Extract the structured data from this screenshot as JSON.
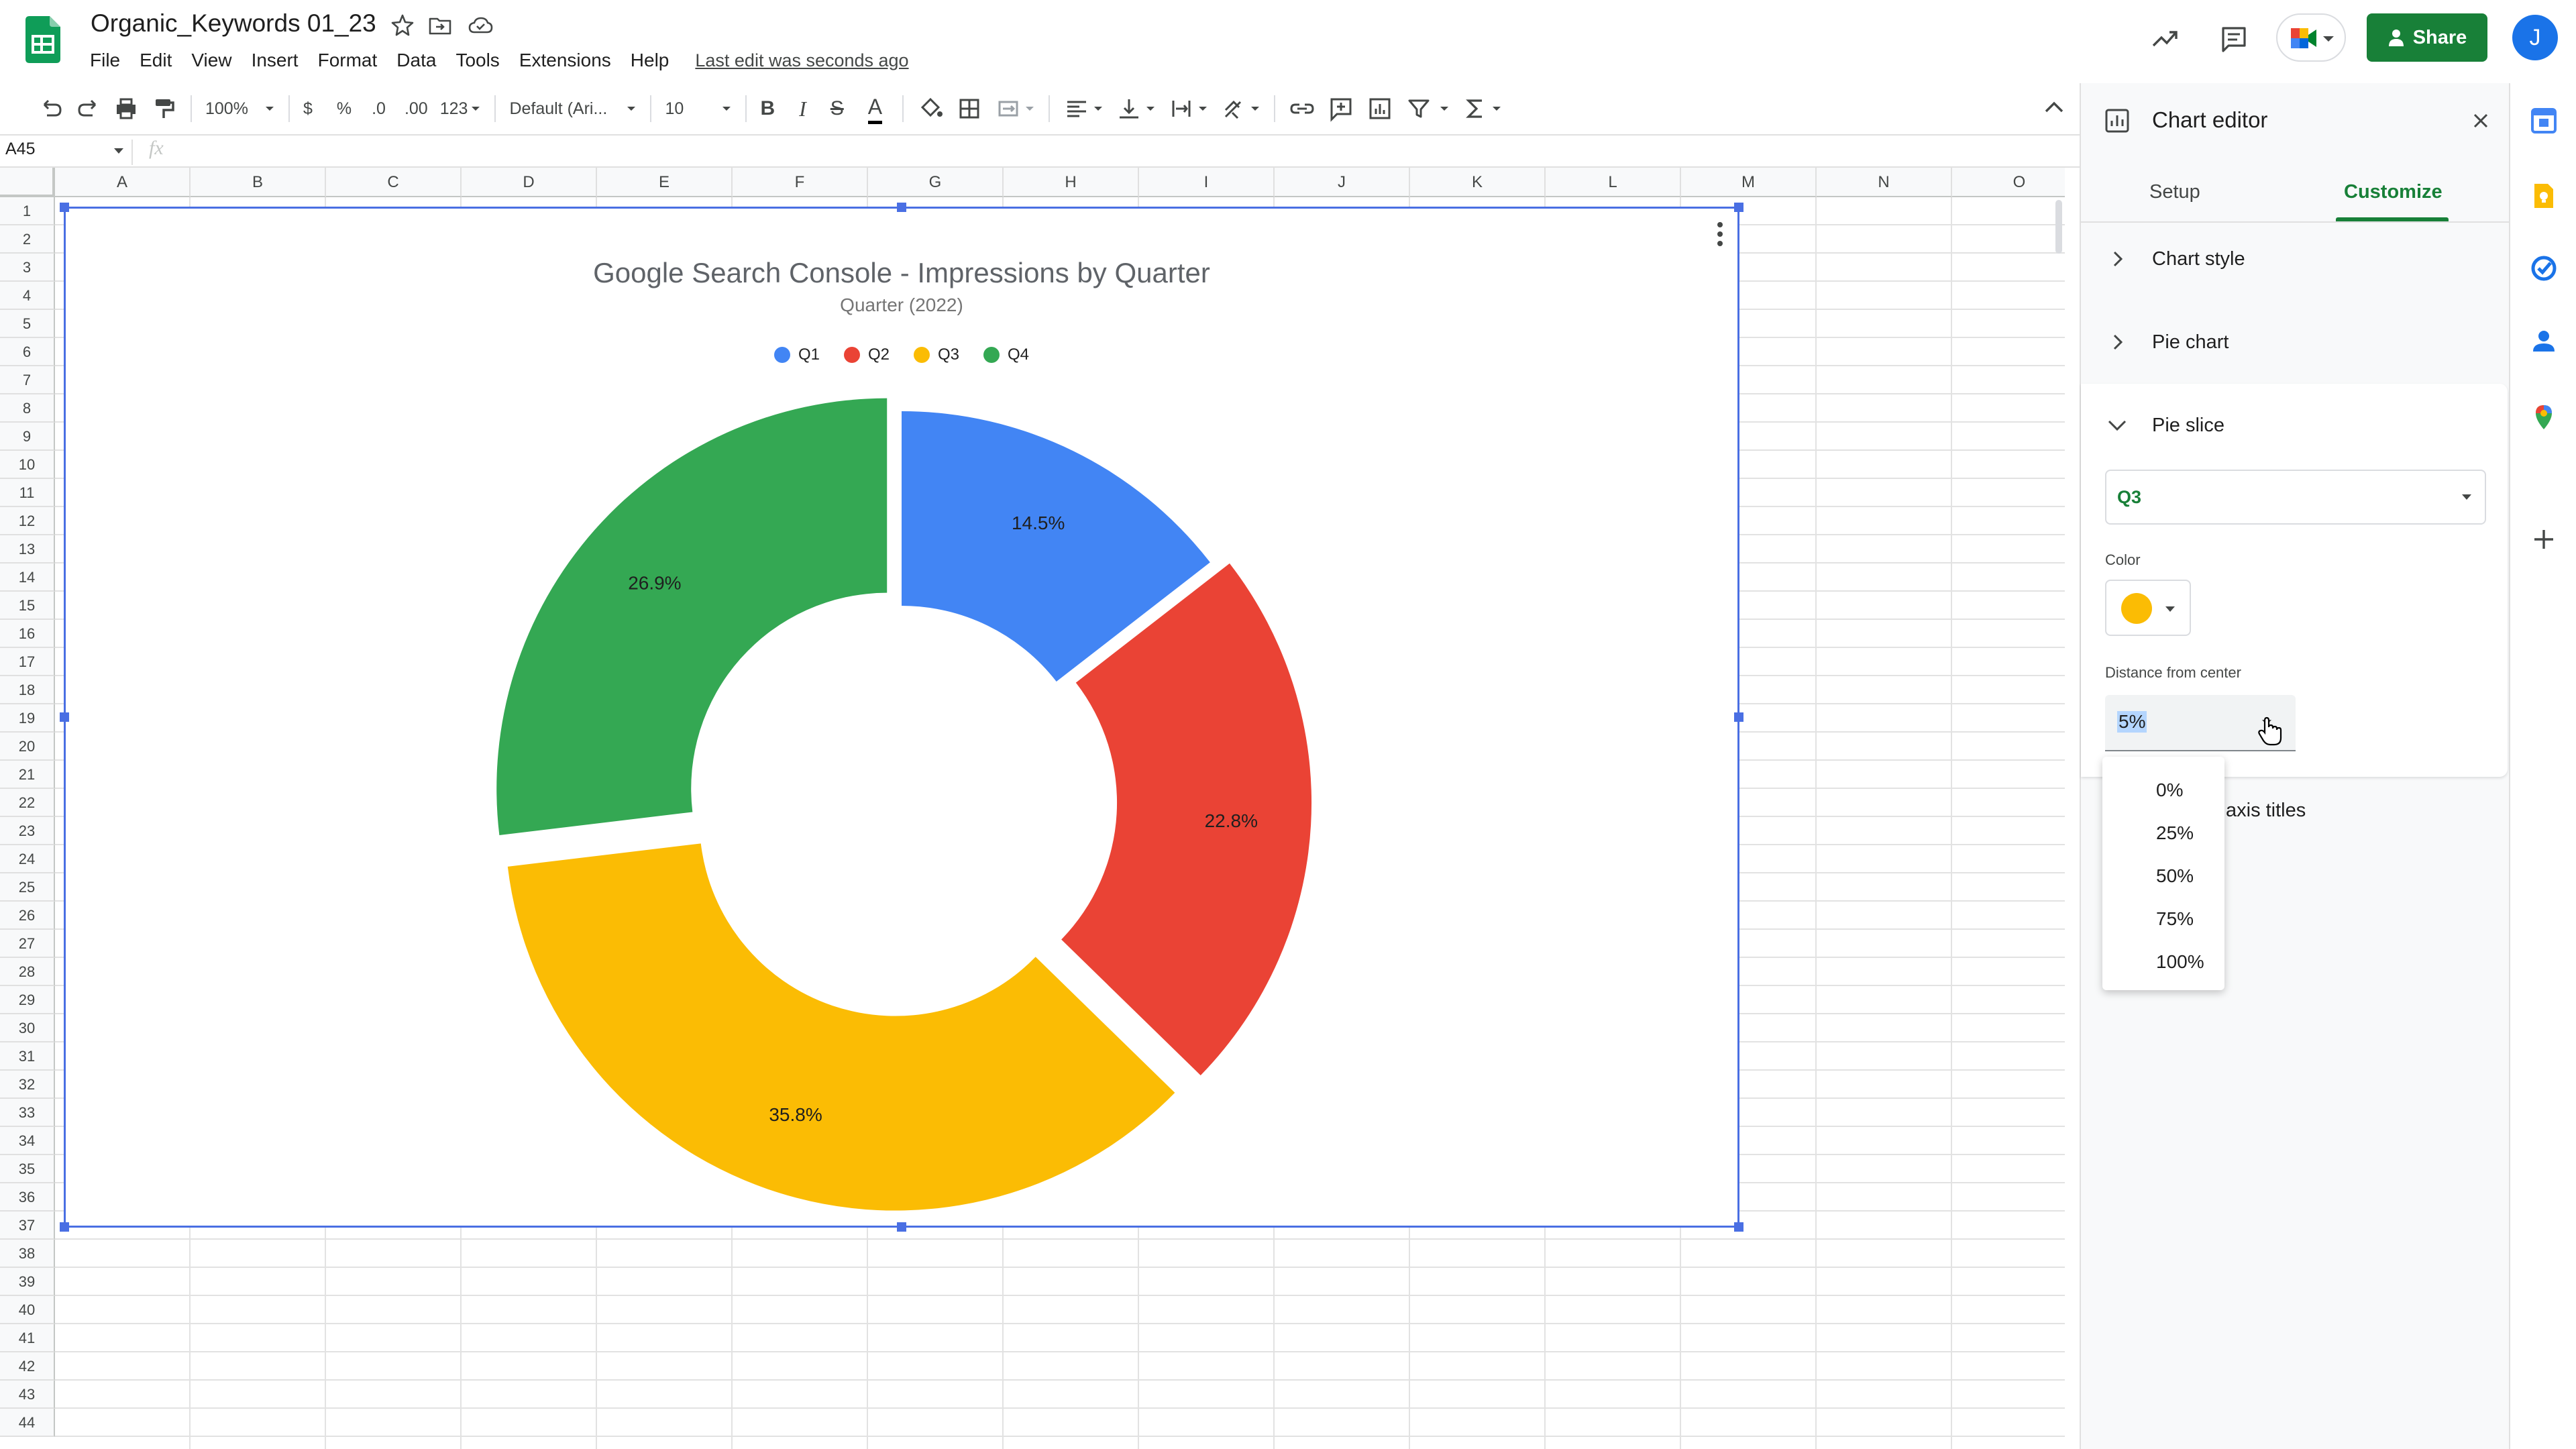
{
  "document": {
    "title": "Organic_Keywords 01_23",
    "last_edit": "Last edit was seconds ago"
  },
  "menu": [
    "File",
    "Edit",
    "View",
    "Insert",
    "Format",
    "Data",
    "Tools",
    "Extensions",
    "Help"
  ],
  "header": {
    "share_label": "Share",
    "avatar_initial": "J"
  },
  "toolbar": {
    "zoom": "100%",
    "currency": "$",
    "percent": "%",
    "decrease_decimal": ".0",
    "increase_decimal": ".00",
    "number_format": "123",
    "font": "Default (Ari...",
    "font_size": "10",
    "bold": "B",
    "italic": "I",
    "strikethrough": "S",
    "text_color": "A"
  },
  "formula_bar": {
    "cell_ref": "A45",
    "fx": "fx"
  },
  "grid": {
    "columns": [
      "A",
      "B",
      "C",
      "D",
      "E",
      "F",
      "G",
      "H",
      "I",
      "J",
      "K",
      "L",
      "M",
      "N",
      "O"
    ],
    "rows": [
      "1",
      "2",
      "3",
      "4",
      "5",
      "6",
      "7",
      "8",
      "9",
      "10",
      "11",
      "12",
      "13",
      "14",
      "15",
      "16",
      "17",
      "18",
      "19",
      "20",
      "21",
      "22",
      "23",
      "24",
      "25",
      "26",
      "27",
      "28",
      "29",
      "30",
      "31",
      "32",
      "33",
      "34",
      "35",
      "36",
      "37",
      "38",
      "39",
      "40",
      "41",
      "42",
      "43",
      "44"
    ]
  },
  "chart_data": {
    "type": "pie",
    "donut": true,
    "title": "Google Search Console - Impressions by Quarter",
    "subtitle": "Quarter (2022)",
    "legend_position": "top",
    "categories": [
      "Q1",
      "Q2",
      "Q3",
      "Q4"
    ],
    "values": [
      14.5,
      22.8,
      35.8,
      26.9
    ],
    "labels": [
      "14.5%",
      "22.8%",
      "35.8%",
      "26.9%"
    ],
    "colors": [
      "#4285f4",
      "#ea4335",
      "#fbbc04",
      "#34a853"
    ],
    "exploded": [
      0,
      0.05,
      0.05,
      0.05
    ]
  },
  "chart_editor": {
    "title": "Chart editor",
    "tabs": [
      "Setup",
      "Customize"
    ],
    "active_tab": "Customize",
    "sections": {
      "chart_style": "Chart style",
      "pie_chart": "Pie chart",
      "pie_slice": "Pie slice",
      "axis_titles": "axis titles"
    },
    "slice_selected": "Q3",
    "color_label": "Color",
    "slice_color": "#fbbc04",
    "distance_label": "Distance from center",
    "distance_value": "5%",
    "distance_options": [
      "0%",
      "25%",
      "50%",
      "75%",
      "100%"
    ]
  },
  "colors": {
    "accent_green": "#188038",
    "selection_blue": "#4a6fe3",
    "avatar_blue": "#1a73e8"
  }
}
